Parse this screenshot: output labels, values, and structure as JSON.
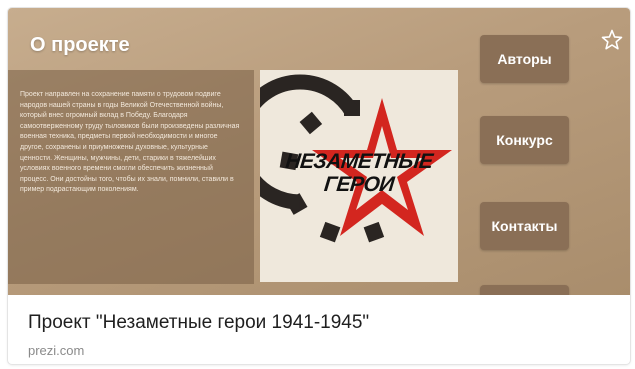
{
  "slide": {
    "title": "О проекте",
    "body": "Проект направлен на сохранение памяти о трудовом подвиге народов нашей страны в годы Великой Отечественной войны, который внес огромный вклад в Победу. Благодаря самоотверженному труду тыловиков были произведены различная военная техника, предметы первой необходимости и многое другое, сохранены и приумножены духовные, культурные ценности. Женщины, мужчины, дети, старики в тяжелейших условиях военного времени смогли обеспечить жизненный процесс. Они достойны того, чтобы их знали, помнили, ставили в пример подрастающим поколениям.",
    "logo_line1": "НЕЗАМЕТНЫЕ",
    "logo_line2": "ГЕРОИ",
    "nav": {
      "authors": "Авторы",
      "contest": "Конкурс",
      "contacts": "Контакты"
    }
  },
  "link": {
    "title": "Проект \"Незаметные герои 1941-1945\"",
    "domain": "prezi.com"
  },
  "icons": {
    "favorite": "star-outline-icon"
  },
  "colors": {
    "slide_background": "#b89c7c",
    "button": "#8a6f56",
    "logo_star": "#d3261f",
    "logo_gear": "#2a2522"
  }
}
